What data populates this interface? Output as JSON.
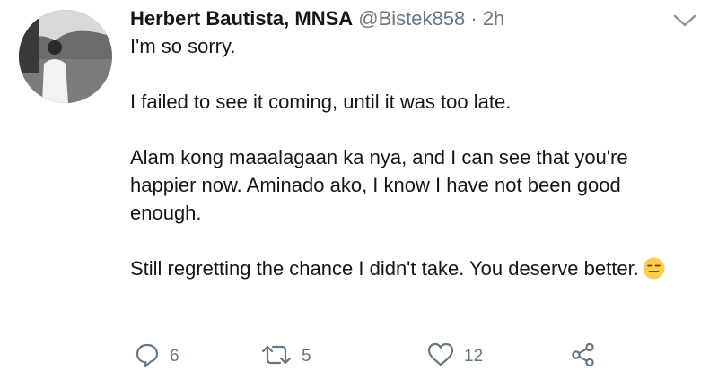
{
  "tweet": {
    "author": {
      "display_name": "Herbert Bautista, MNSA",
      "handle": "@Bistek858",
      "separator": "·",
      "time": "2h"
    },
    "paragraphs": [
      "I'm so sorry.",
      "I failed to see it coming, until it was too late.",
      "Alam kong maaalagaan ka nya, and I can see that you're happier now. Aminado ako, I know I have not been good enough.",
      "Still regretting the chance I didn't take. You deserve better."
    ],
    "emoji": "expressionless-face-emoji",
    "actions": {
      "reply_count": "6",
      "retweet_count": "5",
      "like_count": "12"
    }
  },
  "colors": {
    "text": "#14171a",
    "secondary": "#657786",
    "emoji": "#ffcc4d"
  },
  "icons": [
    "reply-icon",
    "retweet-icon",
    "like-icon",
    "share-icon",
    "chevron-down-icon"
  ]
}
